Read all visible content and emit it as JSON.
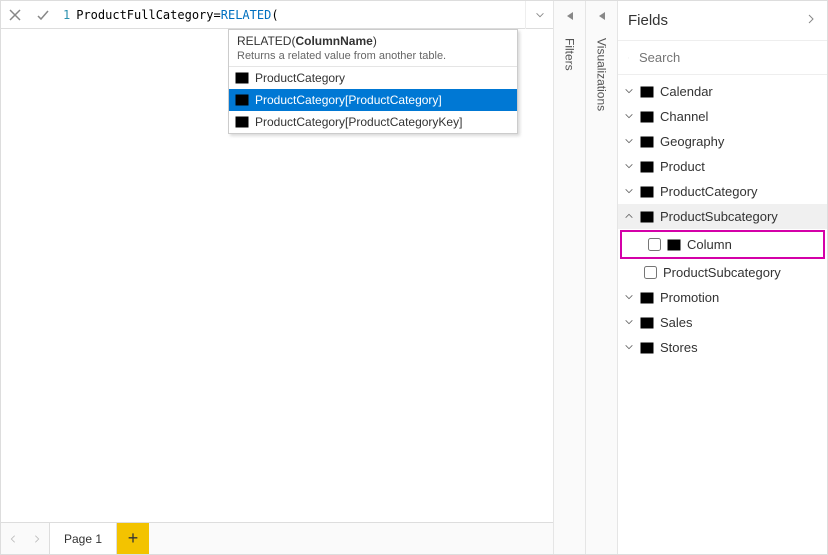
{
  "formula": {
    "line_no": "1",
    "column_name": "ProductFullCategory",
    "operator": "=",
    "function": "RELATED",
    "paren": "("
  },
  "tooltip": {
    "fn": "RELATED",
    "arg": "ColumnName",
    "desc": "Returns a related value from another table.",
    "suggestions": [
      {
        "label": "ProductCategory",
        "selected": false
      },
      {
        "label": "ProductCategory[ProductCategory]",
        "selected": true
      },
      {
        "label": "ProductCategory[ProductCategoryKey]",
        "selected": false
      }
    ]
  },
  "collapse_panes": {
    "filters": "Filters",
    "visualizations": "Visualizations"
  },
  "fields": {
    "title": "Fields",
    "search_placeholder": "Search",
    "tables": [
      {
        "name": "Calendar",
        "expanded": false
      },
      {
        "name": "Channel",
        "expanded": false
      },
      {
        "name": "Geography",
        "expanded": false
      },
      {
        "name": "Product",
        "expanded": false
      },
      {
        "name": "ProductCategory",
        "expanded": false
      },
      {
        "name": "ProductSubcategory",
        "expanded": true,
        "fields": [
          {
            "name": "Column",
            "checked": false,
            "highlight": true,
            "calc_icon": true
          },
          {
            "name": "ProductSubcategory",
            "checked": false,
            "highlight": false
          }
        ]
      },
      {
        "name": "Promotion",
        "expanded": false
      },
      {
        "name": "Sales",
        "expanded": false
      },
      {
        "name": "Stores",
        "expanded": false
      }
    ]
  },
  "pages": {
    "current": "Page 1"
  }
}
